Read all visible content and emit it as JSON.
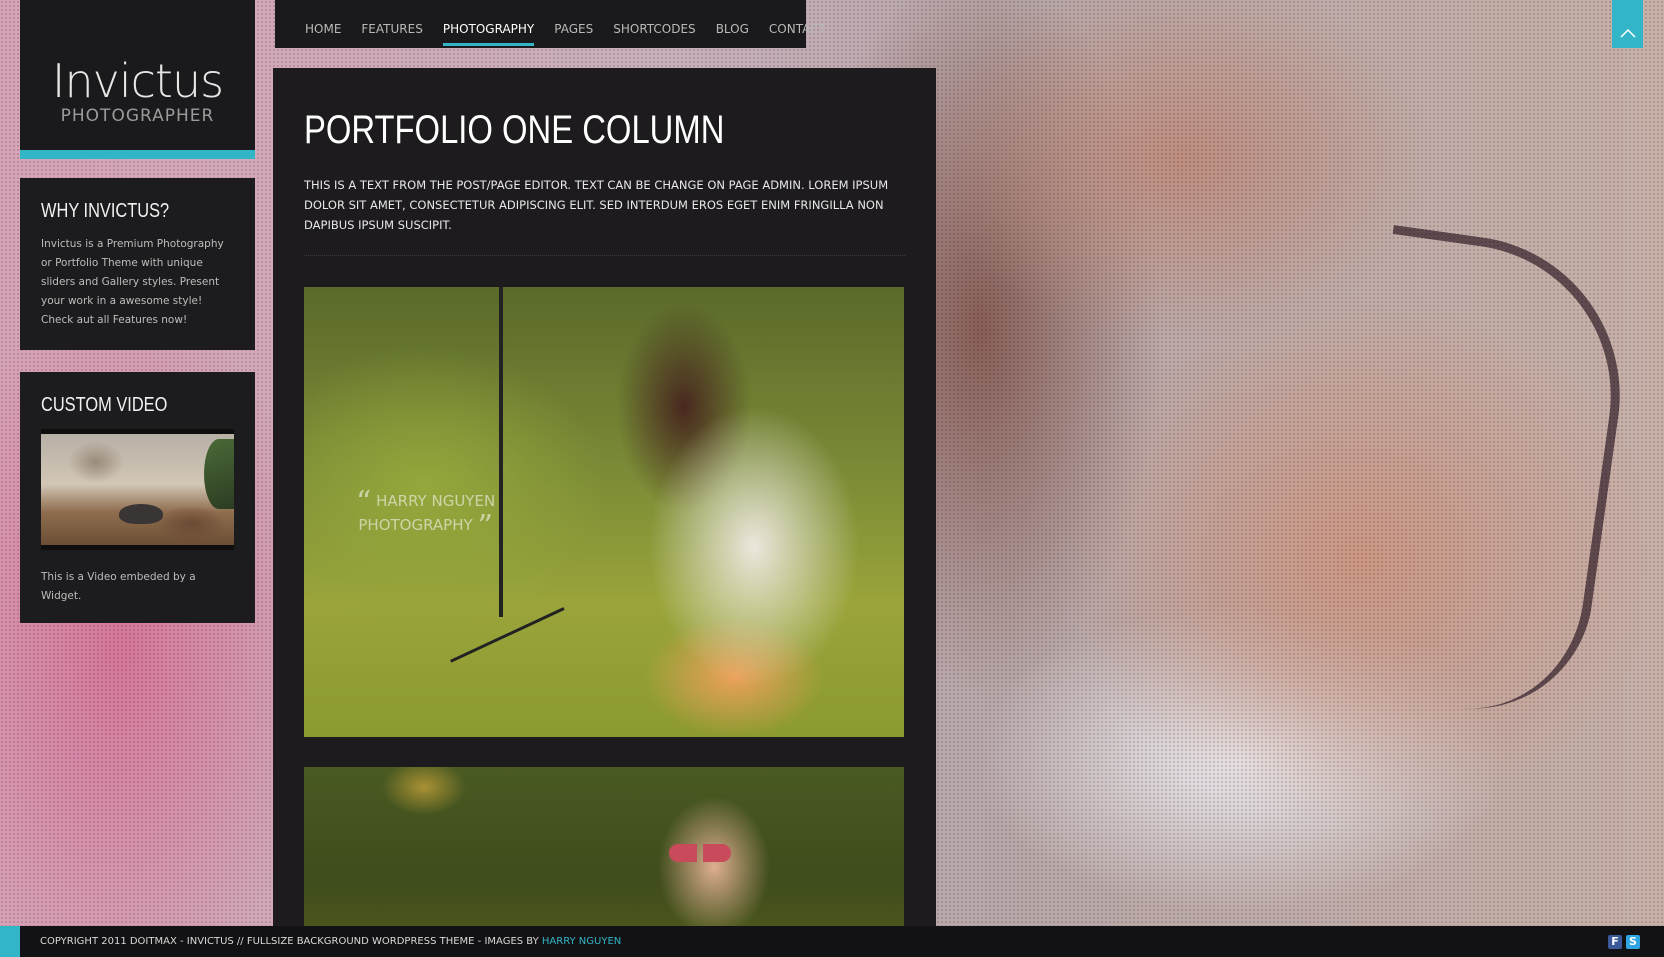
{
  "logo": {
    "name": "Invictus",
    "tagline": "PHOTOGRAPHER"
  },
  "nav": {
    "items": [
      "HOME",
      "FEATURES",
      "PHOTOGRAPHY",
      "PAGES",
      "SHORTCODES",
      "BLOG",
      "CONTACT"
    ],
    "active": "PHOTOGRAPHY"
  },
  "widgets": {
    "why": {
      "title": "WHY INVICTUS?",
      "text": "Invictus is a Premium Photography or Portfolio Theme with unique sliders and Gallery styles. Present your work in a awesome style! Check aut all Features now!"
    },
    "video": {
      "title": "CUSTOM VIDEO",
      "caption": "This is a Video embeded by a Widget."
    }
  },
  "main": {
    "title": "PORTFOLIO ONE COLUMN",
    "intro": "THIS IS A TEXT FROM THE POST/PAGE EDITOR. TEXT CAN BE CHANGE ON PAGE ADMIN. LOREM IPSUM DOLOR SIT AMET, CONSECTETUR ADIPISCING ELIT. SED INTERDUM EROS EGET ENIM FRINGILLA NON DAPIBUS IPSUM SUSCIPIT.",
    "photo1_watermark_line1": "HARRY  NGUYEN",
    "photo1_watermark_line2": "PHOTOGRAPHY"
  },
  "footer": {
    "text": "COPYRIGHT 2011 DOITMAX - INVICTUS // FULLSIZE BACKGROUND WORDPRESS THEME - IMAGES BY",
    "link": "HARRY NGUYEN"
  },
  "colors": {
    "accent": "#33b5c8",
    "panel": "#1c1b1d",
    "footer": "#121214"
  },
  "icons": [
    "scroll-to-top-chevron-icon",
    "facebook-icon",
    "skype-icon"
  ]
}
